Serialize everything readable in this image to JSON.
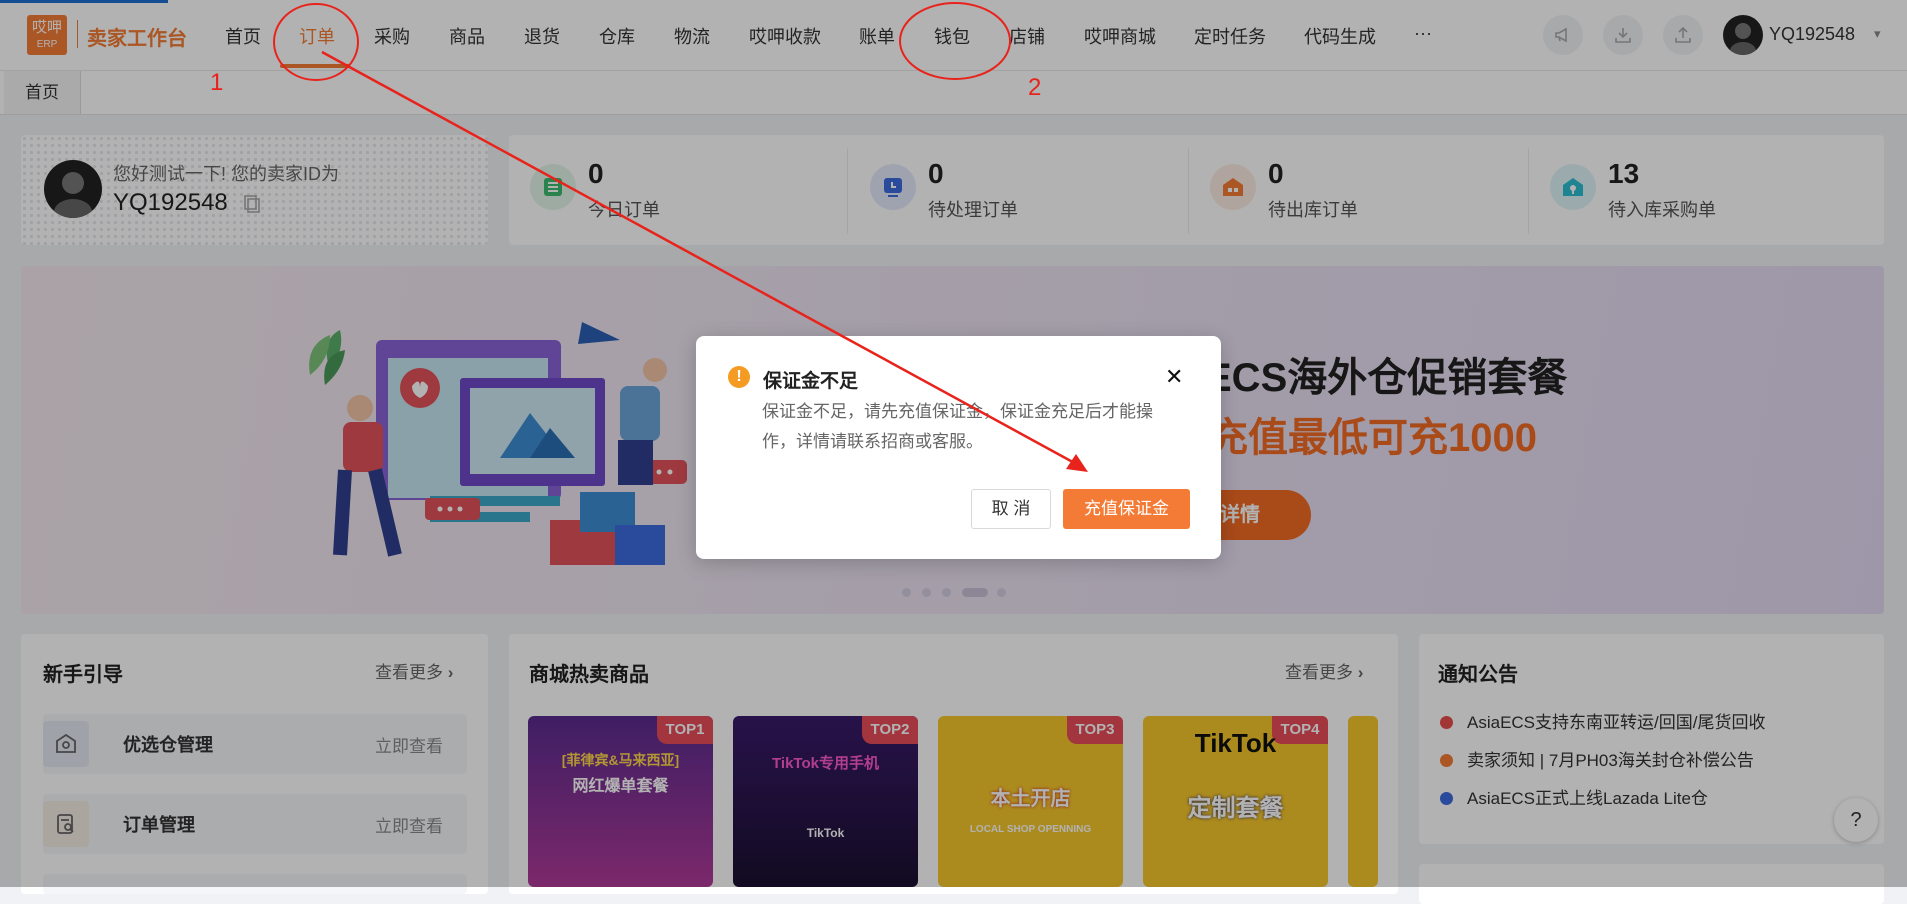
{
  "header": {
    "logo_line1": "哎呷",
    "logo_line2": "ERP",
    "app_title": "卖家工作台",
    "nav": [
      "首页",
      "订单",
      "采购",
      "商品",
      "退货",
      "仓库",
      "物流",
      "哎呷收款",
      "账单",
      "钱包",
      "店铺",
      "哎呷商城",
      "定时任务",
      "代码生成",
      "···"
    ],
    "active_nav": "订单",
    "tools": [
      "megaphone-icon",
      "download-icon",
      "upload-icon"
    ],
    "username": "YQ192548",
    "caret": "▾"
  },
  "tabs": {
    "home": "首页"
  },
  "welcome": {
    "greeting": "您好测试一下! 您的卖家ID为",
    "seller_id": "YQ192548"
  },
  "stats": [
    {
      "value": "0",
      "label": "今日订单",
      "icon": "order-list-icon",
      "color": "#3dbb6f"
    },
    {
      "value": "0",
      "label": "待处理订单",
      "icon": "monitor-icon",
      "color": "#3d6be0"
    },
    {
      "value": "0",
      "label": "待出库订单",
      "icon": "warehouse-icon",
      "color": "#f47b35"
    },
    {
      "value": "13",
      "label": "待入库采购单",
      "icon": "inbound-icon",
      "color": "#2bbdd0"
    }
  ],
  "banner": {
    "title1": "ECS海外仓促销套餐",
    "title2": "充值最低可充1000",
    "button": "详情"
  },
  "guide": {
    "title": "新手引导",
    "more": "查看更多",
    "items": [
      {
        "label": "优选仓管理",
        "link": "立即查看"
      },
      {
        "label": "订单管理",
        "link": "立即查看"
      }
    ]
  },
  "hot": {
    "title": "商城热卖商品",
    "more": "查看更多",
    "products": [
      {
        "badge": "TOP1",
        "line1": "[菲律宾&马来西亚]",
        "line2": "网红爆单套餐"
      },
      {
        "badge": "TOP2",
        "line1": "TikTok专用手机",
        "line2": "TikTok"
      },
      {
        "badge": "TOP3",
        "line1": "本土开店",
        "line2": "LOCAL SHOP OPENNING"
      },
      {
        "badge": "TOP4",
        "line1": "TikTok",
        "line2": "定制套餐"
      }
    ]
  },
  "notice": {
    "title": "通知公告",
    "items": [
      {
        "text": "AsiaECS支持东南亚转运/回国/尾货回收",
        "color": "#e84d4d"
      },
      {
        "text": "卖家须知 | 7月PH03海关封仓补偿公告",
        "color": "#f47b35"
      },
      {
        "text": "AsiaECS正式上线Lazada Lite仓",
        "color": "#3d6be0"
      }
    ]
  },
  "help": "?",
  "dialog": {
    "icon": "!",
    "title": "保证金不足",
    "body": "保证金不足，请先充值保证金，保证金充足后才能操作，详情请联系招商或客服。",
    "close": "✕",
    "cancel": "取 消",
    "confirm": "充值保证金"
  },
  "annotations": {
    "label1": "1",
    "label2": "2",
    "color": "#e8231b"
  }
}
